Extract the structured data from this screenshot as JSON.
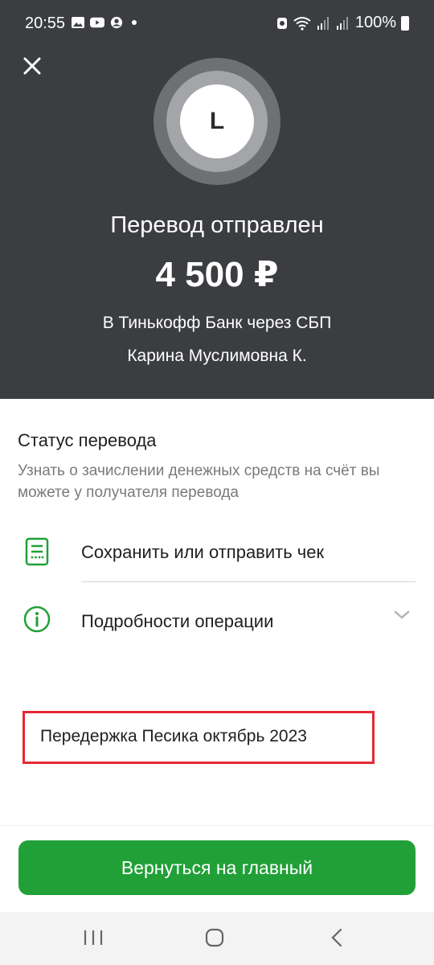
{
  "status_bar": {
    "time": "20:55",
    "battery": "100%"
  },
  "header": {
    "avatar_letter": "L",
    "title": "Перевод отправлен",
    "amount": "4 500 ₽",
    "bank_line": "В Тинькофф Банк через СБП",
    "recipient": "Карина Муслимовна К."
  },
  "status": {
    "title": "Статус перевода",
    "description": "Узнать о зачислении денежных средств на счёт вы можете у получателя перевода"
  },
  "actions": [
    {
      "label": "Сохранить или отправить чек",
      "icon": "receipt-icon"
    },
    {
      "label": "Подробности операции",
      "icon": "info-icon"
    }
  ],
  "comment": "Передержка Песика октябрь 2023",
  "main_button": "Вернуться на главный",
  "colors": {
    "header_bg": "#3b3d40",
    "accent_green": "#21a038",
    "highlight_red": "#e52935"
  }
}
